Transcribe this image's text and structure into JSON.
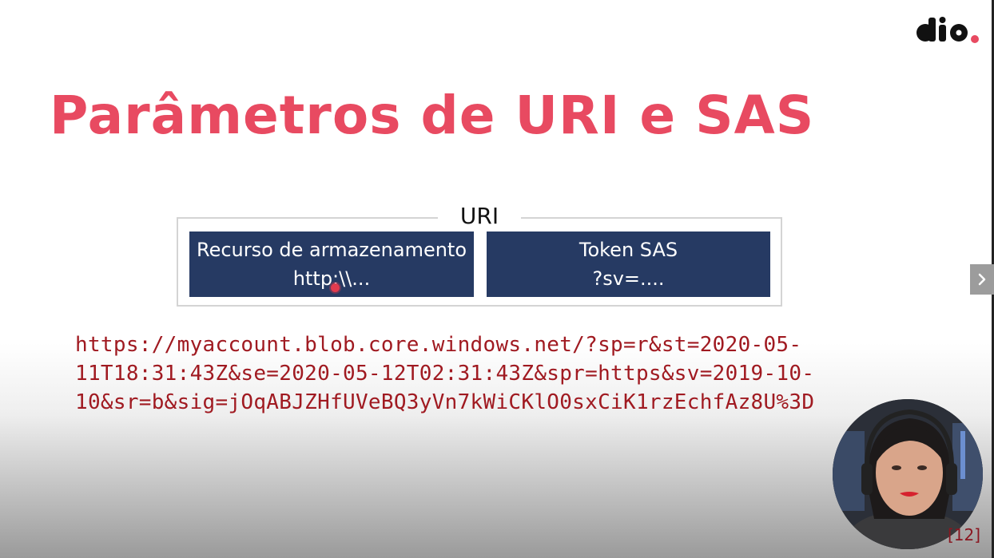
{
  "slide": {
    "title": "Parâmetros de URI e SAS",
    "brand": {
      "logo_text": "dio",
      "accent_color": "#e84a61"
    },
    "uri_diagram": {
      "label": "URI",
      "left_box": {
        "line1": "Recurso de armazenamento",
        "line2": "http:\\\\..."
      },
      "right_box": {
        "line1": "Token SAS",
        "line2": "?sv=...."
      },
      "box_color": "#263a63"
    },
    "example_url": [
      "https://myaccount.blob.core.windows.net/?sp=r&st=2020-05-",
      "11T18:31:43Z&se=2020-05-12T02:31:43Z&spr=https&sv=2019-10-",
      "10&sr=b&sig=jOqABJZHfUVeBQ3yVn7kWiCKlO0sxCiK1rzEchfAz8U%3D"
    ],
    "slide_number": "[12]"
  },
  "controls": {
    "next_icon": "chevron-right-icon"
  }
}
